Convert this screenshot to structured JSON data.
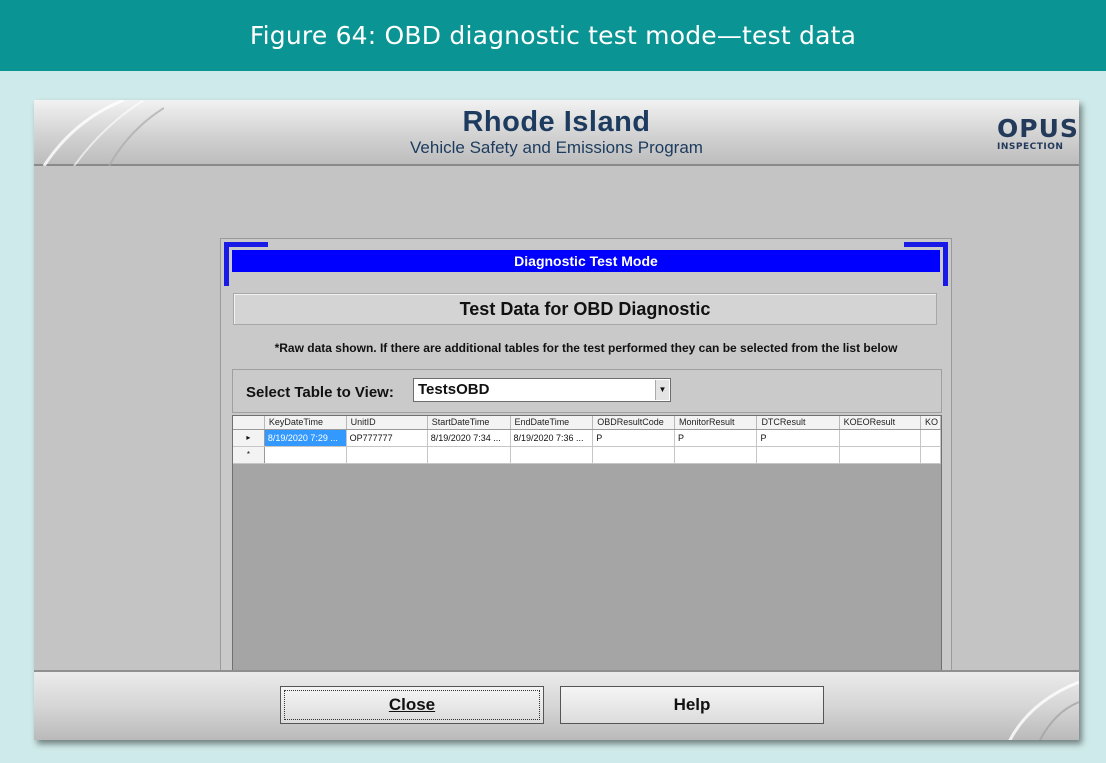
{
  "figure": {
    "title": "Figure 64: OBD diagnostic test mode—test data"
  },
  "banner": {
    "title": "Rhode Island",
    "subtitle": "Vehicle Safety and Emissions Program",
    "logo_main": "OPUS",
    "logo_sub": "INSPECTION"
  },
  "dialog": {
    "title": "Diagnostic Test Mode",
    "subtitle": "Test Data for OBD Diagnostic",
    "note": "*Raw data shown. If there are additional tables for the test performed they can be selected from the list below",
    "select_label": "Select Table to View:",
    "select_value": "TestsOBD"
  },
  "grid": {
    "columns": [
      "KeyDateTime",
      "UnitID",
      "StartDateTime",
      "EndDateTime",
      "OBDResultCode",
      "MonitorResult",
      "DTCResult",
      "KOEOResult",
      "KO"
    ],
    "rows": [
      {
        "indicator": "▸",
        "cells": [
          "8/19/2020 7:29 ...",
          "OP777777",
          "8/19/2020 7:34 ...",
          "8/19/2020 7:36 ...",
          "P",
          "P",
          "P",
          "",
          ""
        ]
      },
      {
        "indicator": "*",
        "cells": [
          "",
          "",
          "",
          "",
          "",
          "",
          "",
          "",
          ""
        ]
      }
    ]
  },
  "buttons": {
    "close": "Close",
    "help": "Help"
  }
}
